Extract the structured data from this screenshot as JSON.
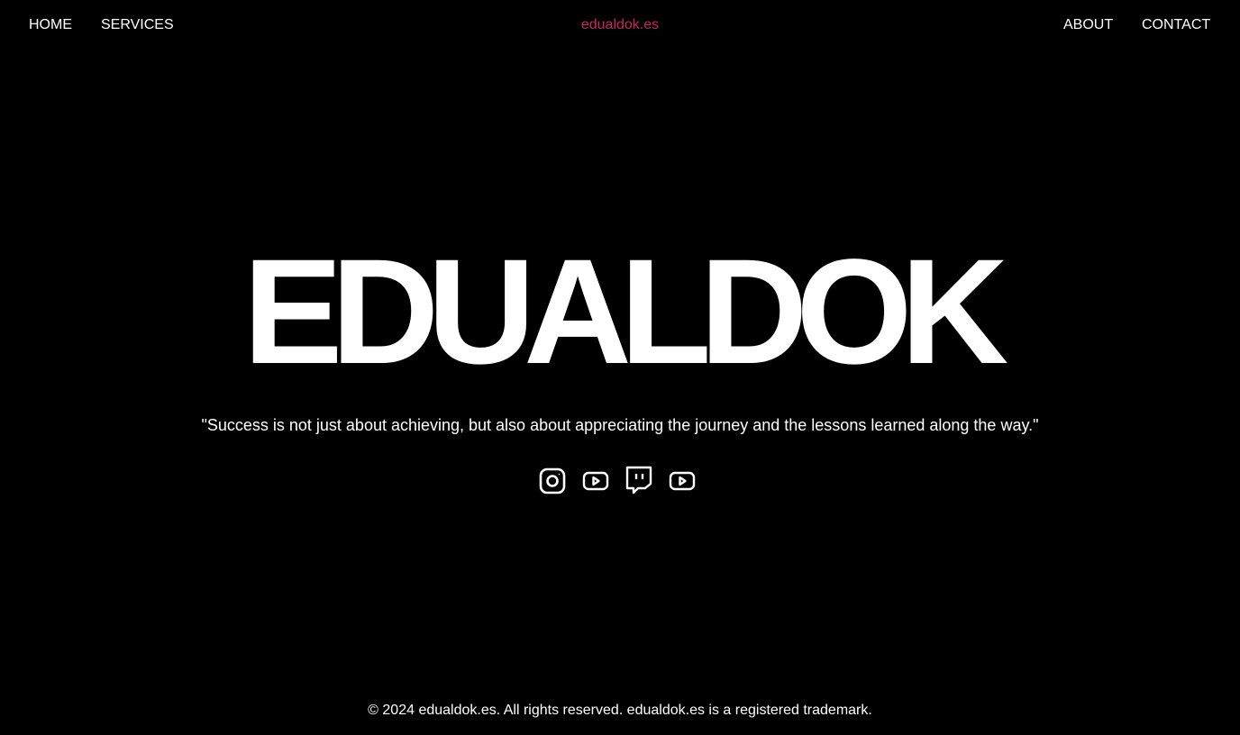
{
  "nav": {
    "home": "HOME",
    "services": "SERVICES",
    "brand": "edualdok.es",
    "about": "ABOUT",
    "contact": "CONTACT"
  },
  "hero": {
    "title": "EDUALDOK",
    "quote": "\"Success is not just about achieving, but also about appreciating the journey and the lessons learned along the way.\""
  },
  "social": [
    "instagram-icon",
    "youtube-icon",
    "twitch-icon",
    "youtube-icon"
  ],
  "footer": {
    "text": "© 2024 edualdok.es. All rights reserved. edualdok.es is a registered trademark."
  },
  "colors": {
    "accent": "#c2285b",
    "background": "#000000",
    "text": "#ffffff"
  }
}
